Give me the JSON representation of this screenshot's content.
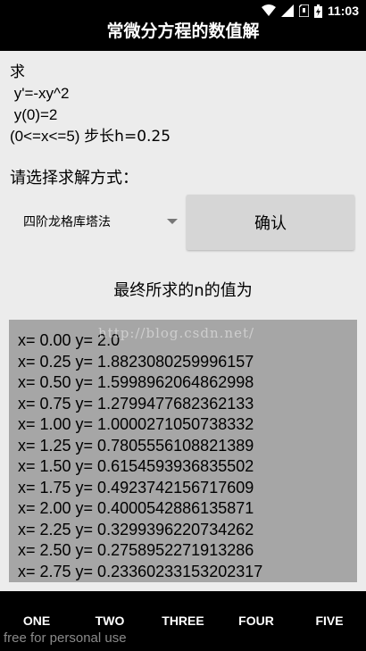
{
  "status_bar": {
    "time": "11:03",
    "icons": [
      "wifi-icon",
      "signal-icon",
      "sd-card-icon",
      "battery-icon"
    ]
  },
  "app_bar": {
    "title": "常微分方程的数值解"
  },
  "problem": {
    "heading": "求",
    "equation": " y'=-xy^2",
    "initial": " y(0)=2",
    "range_prefix": "(0<=x<=5) ",
    "range_step": "步长h=0.25"
  },
  "method": {
    "prompt": "请选择求解方式：",
    "selected": "四阶龙格库塔法",
    "confirm_label": "确认"
  },
  "results": {
    "title": "最终所求的n的值为",
    "watermark": "http://blog.csdn.net/",
    "rows": [
      "x= 0.00 y= 2.0",
      "x= 0.25 y= 1.8823080259996157",
      "x= 0.50 y= 1.5998962064862998",
      "x= 0.75 y= 1.2799477682362133",
      "x= 1.00 y= 1.0000271050738332",
      "x= 1.25 y= 0.7805556108821389",
      "x= 1.50 y= 0.6154593936835502",
      "x= 1.75 y= 0.4923742156717609",
      "x= 2.00 y= 0.4000542886135871",
      "x= 2.25 y= 0.3299396220734262",
      "x= 2.50 y= 0.2758952271913286",
      "x= 2.75 y= 0.23360233153202317"
    ]
  },
  "tabs": [
    "ONE",
    "TWO",
    "THREE",
    "FOUR",
    "FIVE"
  ],
  "footer_note": "free for personal use",
  "colors": {
    "bar_background": "#000000",
    "page_background": "#ececec",
    "results_background": "#a6a6a6",
    "button_background": "#d6d6d6"
  }
}
